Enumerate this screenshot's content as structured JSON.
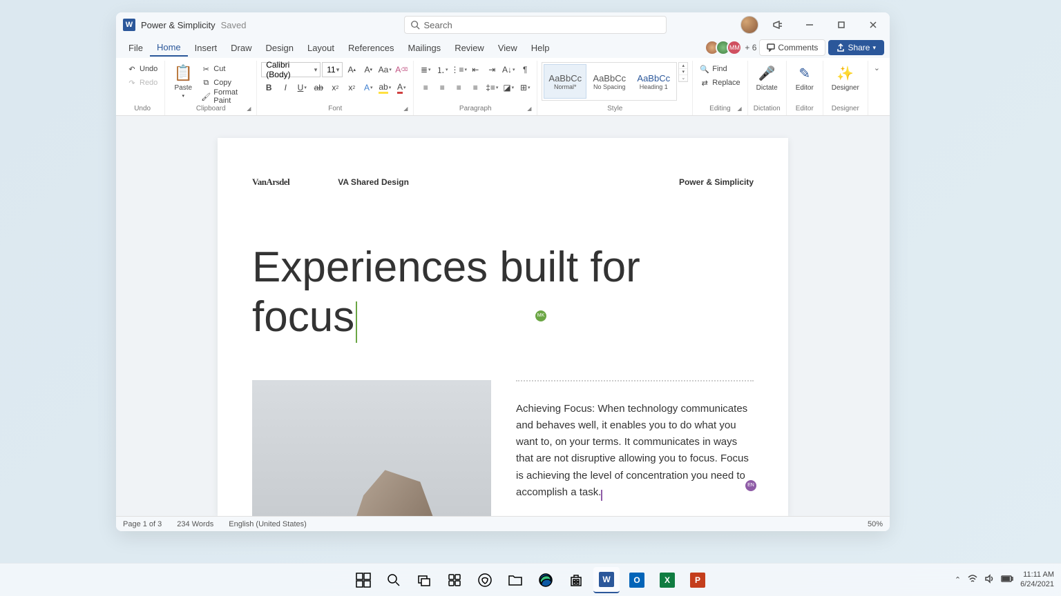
{
  "titlebar": {
    "app_letter": "W",
    "doc_title": "Power & Simplicity",
    "saved": "Saved",
    "search_placeholder": "Search"
  },
  "tabs": {
    "file": "File",
    "home": "Home",
    "insert": "Insert",
    "draw": "Draw",
    "design": "Design",
    "layout": "Layout",
    "references": "References",
    "mailings": "Mailings",
    "review": "Review",
    "view": "View",
    "help": "Help",
    "more": "+ 6",
    "comments": "Comments",
    "share": "Share"
  },
  "presence": {
    "mm": "MM"
  },
  "ribbon": {
    "undo": "Undo",
    "redo": "Redo",
    "undo_group": "Undo",
    "paste": "Paste",
    "cut": "Cut",
    "copy": "Copy",
    "format_paint": "Format Paint",
    "clipboard": "Clipboard",
    "font_name": "Calibri (Body)",
    "font_size": "11",
    "font_group": "Font",
    "paragraph": "Paragraph",
    "style_normal": "Normal*",
    "style_nospacing": "No Spacing",
    "style_h1": "Heading 1",
    "style_prev": "AaBbCc",
    "style_group": "Style",
    "find": "Find",
    "replace": "Replace",
    "editing": "Editing",
    "dictate": "Dictate",
    "dictation": "Dictation",
    "editor": "Editor",
    "editor_group": "Editor",
    "designer": "Designer",
    "designer_group": "Designer"
  },
  "document": {
    "brand": "VanArsdel",
    "header_mid": "VA Shared Design",
    "header_right": "Power & Simplicity",
    "heading": "Experiences built for focus",
    "cursor1": "MK",
    "cursor2": "EN",
    "body": "Achieving Focus: When technology communicates and behaves well, it enables you to do what you want to, on your terms. It communicates in ways that are not disruptive allowing you to focus. Focus is achieving the level of concentration you need to accomplish a task."
  },
  "status": {
    "page": "Page 1 of 3",
    "words": "234 Words",
    "lang": "English (United States)",
    "zoom": "50%"
  },
  "tray": {
    "time": "11:11 AM",
    "date": "6/24/2021"
  }
}
